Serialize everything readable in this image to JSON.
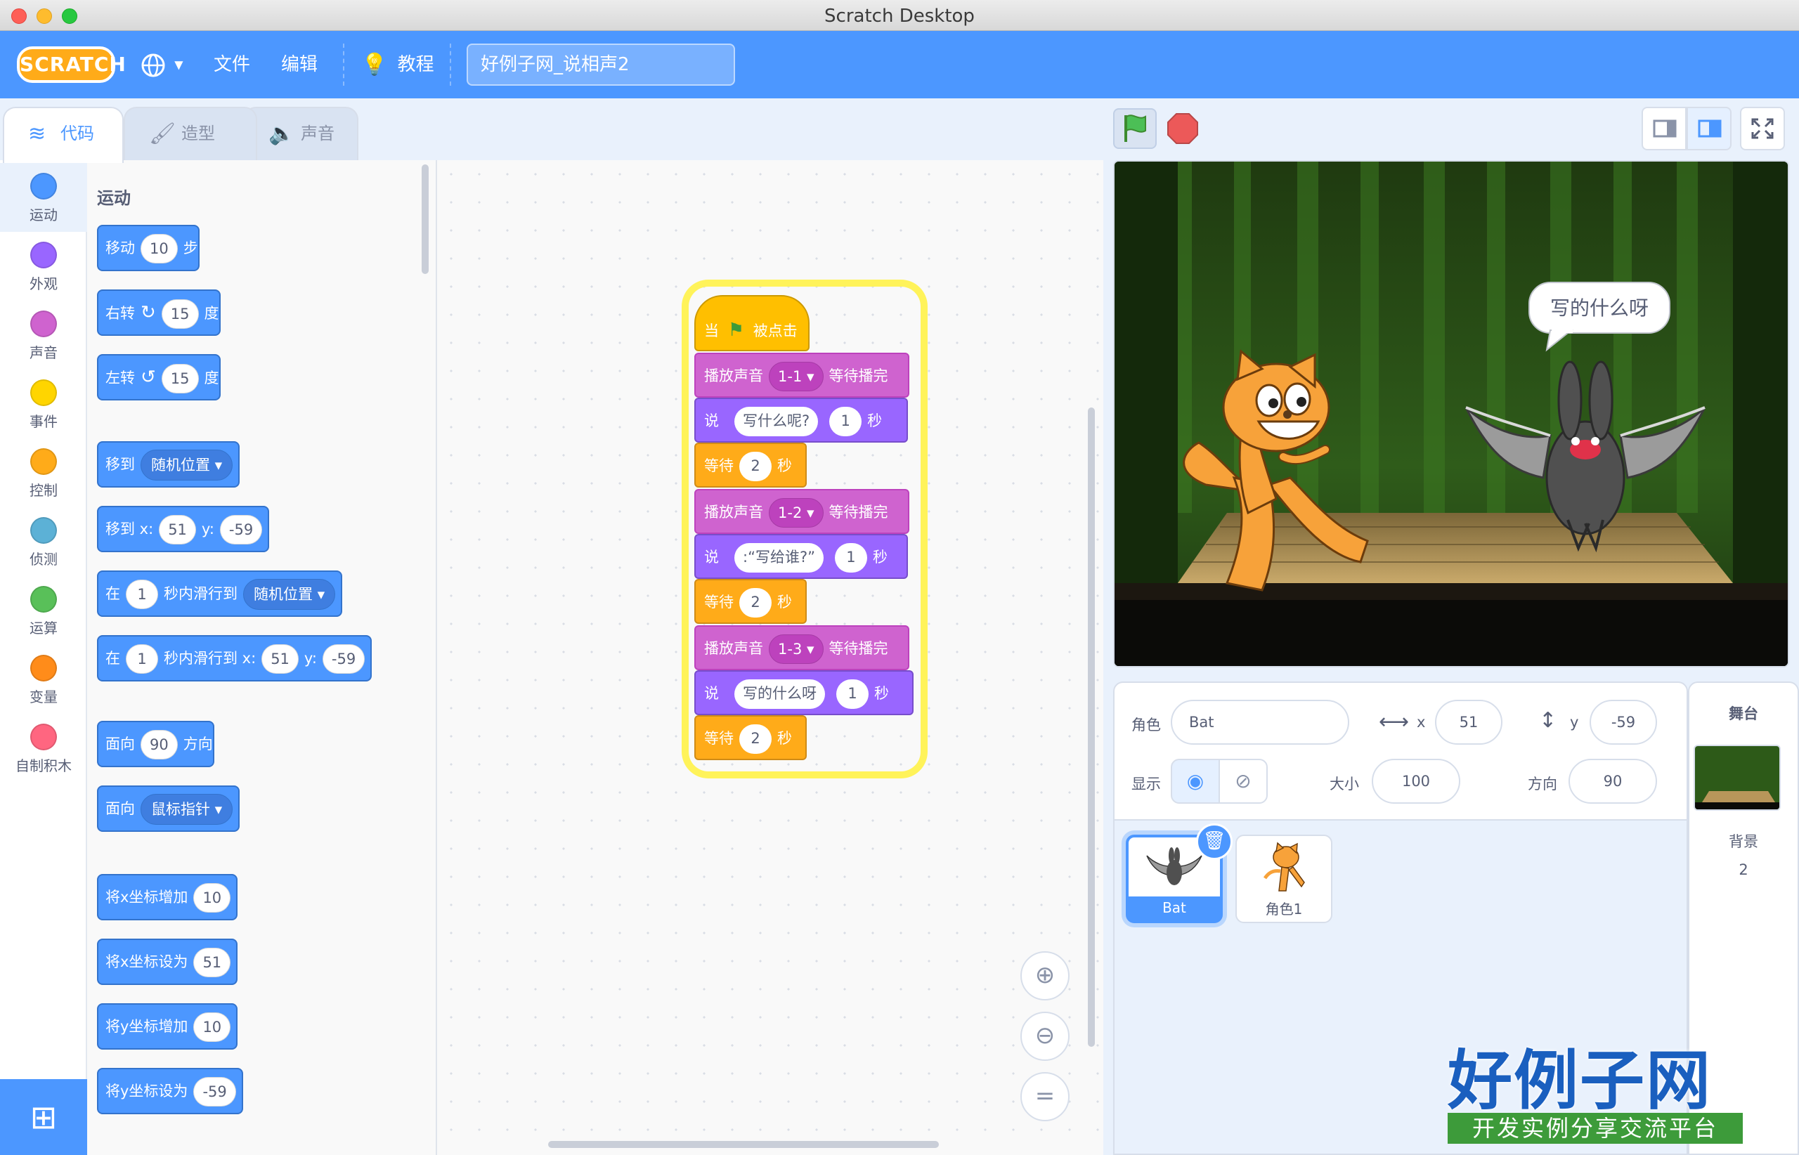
{
  "window": {
    "title": "Scratch Desktop"
  },
  "menubar": {
    "logo": "SCRATCH",
    "file": "文件",
    "edit": "编辑",
    "tutorials": "教程",
    "project_title": "好例子网_说相声2"
  },
  "tabs": [
    {
      "label": "代码",
      "icon": "code-icon"
    },
    {
      "label": "造型",
      "icon": "brush-icon"
    },
    {
      "label": "声音",
      "icon": "speaker-icon"
    }
  ],
  "categories": [
    {
      "label": "运动",
      "color": "#4c97ff"
    },
    {
      "label": "外观",
      "color": "#9966ff"
    },
    {
      "label": "声音",
      "color": "#cf63cf"
    },
    {
      "label": "事件",
      "color": "#ffd500"
    },
    {
      "label": "控制",
      "color": "#ffab19"
    },
    {
      "label": "侦测",
      "color": "#5cb1d6"
    },
    {
      "label": "运算",
      "color": "#59c059"
    },
    {
      "label": "变量",
      "color": "#ff8c1a"
    },
    {
      "label": "自制积木",
      "color": "#ff6680"
    }
  ],
  "palette": {
    "heading": "运动",
    "blocks": [
      {
        "parts": [
          "移动",
          "10",
          "步"
        ]
      },
      {
        "parts": [
          "右转",
          "15",
          "度"
        ]
      },
      {
        "parts": [
          "左转",
          "15",
          "度"
        ]
      },
      {
        "parts": [
          "移到",
          "随机位置"
        ]
      },
      {
        "parts": [
          "移到 x:",
          "51",
          "y:",
          "-59"
        ]
      },
      {
        "parts": [
          "在",
          "1",
          "秒内滑行到",
          "随机位置"
        ]
      },
      {
        "parts": [
          "在",
          "1",
          "秒内滑行到 x:",
          "51",
          "y:",
          "-59"
        ]
      },
      {
        "parts": [
          "面向",
          "90",
          "方向"
        ]
      },
      {
        "parts": [
          "面向",
          "鼠标指针"
        ]
      },
      {
        "parts": [
          "将x坐标增加",
          "10"
        ]
      },
      {
        "parts": [
          "将x坐标设为",
          "51"
        ]
      },
      {
        "parts": [
          "将y坐标增加",
          "10"
        ]
      },
      {
        "parts": [
          "将y坐标设为",
          "-59"
        ]
      }
    ]
  },
  "script": {
    "hat": {
      "when": "当",
      "clicked": "被点击"
    },
    "blocks": [
      {
        "kind": "sound",
        "a": "播放声音",
        "b": "1-1",
        "c": "等待播完"
      },
      {
        "kind": "looks",
        "a": "说",
        "b": "写什么呢?",
        "c": "1",
        "d": "秒"
      },
      {
        "kind": "control",
        "a": "等待",
        "b": "2",
        "c": "秒"
      },
      {
        "kind": "sound",
        "a": "播放声音",
        "b": "1-2",
        "c": "等待播完"
      },
      {
        "kind": "looks",
        "a": "说",
        "b": ":“写给谁?”",
        "c": "1",
        "d": "秒"
      },
      {
        "kind": "control",
        "a": "等待",
        "b": "2",
        "c": "秒"
      },
      {
        "kind": "sound",
        "a": "播放声音",
        "b": "1-3",
        "c": "等待播完"
      },
      {
        "kind": "looks",
        "a": "说",
        "b": "写的什么呀",
        "c": "1",
        "d": "秒"
      },
      {
        "kind": "control",
        "a": "等待",
        "b": "2",
        "c": "秒"
      }
    ]
  },
  "stage": {
    "speech": "写的什么呀"
  },
  "sprite_info": {
    "sprite_label": "角色",
    "sprite_name": "Bat",
    "x_label": "x",
    "x": "51",
    "y_label": "y",
    "y": "-59",
    "show_label": "显示",
    "size_label": "大小",
    "size": "100",
    "direction_label": "方向",
    "direction": "90"
  },
  "sprites": [
    {
      "name": "Bat",
      "selected": true
    },
    {
      "name": "角色1",
      "selected": false
    }
  ],
  "stage_pane": {
    "title": "舞台",
    "backdrop_label": "背景",
    "backdrop_count": "2"
  },
  "watermark": {
    "title": "好例子网",
    "subtitle": "开发实例分享交流平台"
  }
}
